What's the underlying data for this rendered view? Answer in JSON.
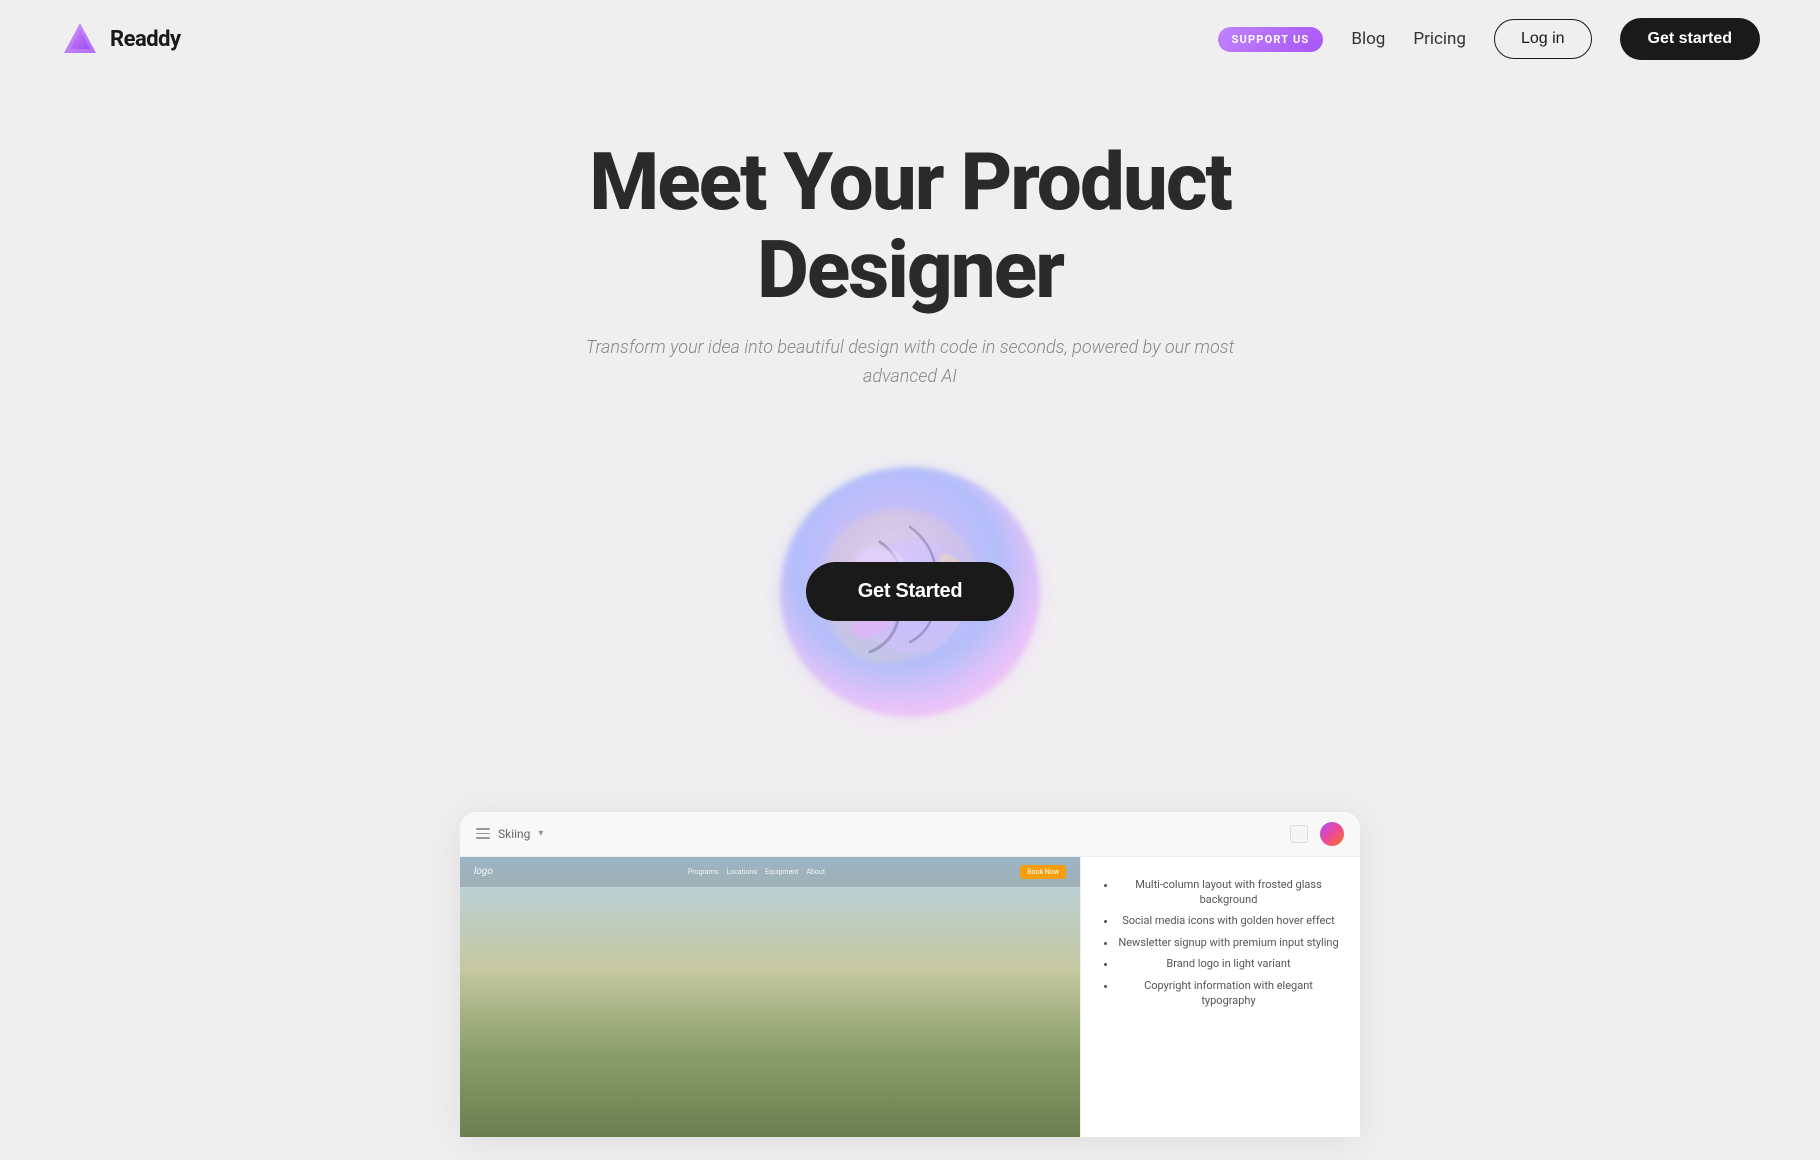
{
  "brand": {
    "name": "Readdy",
    "logo_alt": "Readdy triangle logo"
  },
  "nav": {
    "support_label": "SUPPORT US",
    "blog_label": "Blog",
    "pricing_label": "Pricing",
    "login_label": "Log in",
    "get_started_label": "Get started"
  },
  "hero": {
    "title": "Meet Your Product Designer",
    "subtitle": "Transform your idea into beautiful design with code in seconds, powered by our most advanced AI",
    "cta_label": "Get Started"
  },
  "preview": {
    "tab_label": "Skiing",
    "webpage_logo": "logo",
    "nav_links": [
      "Programs",
      "Locations",
      "Equipment",
      "About"
    ],
    "cta_btn": "Book Now",
    "description_items": [
      "Multi-column layout with frosted glass background",
      "Social media icons with golden hover effect",
      "Newsletter signup with premium input styling",
      "Brand logo in light variant",
      "Copyright information with elegant typography"
    ]
  },
  "colors": {
    "background": "#f0eff0",
    "dark": "#1a1a1a",
    "purple_gradient_start": "#c084fc",
    "purple_gradient_end": "#a855f7",
    "accent_cta": "#f59e0b"
  }
}
